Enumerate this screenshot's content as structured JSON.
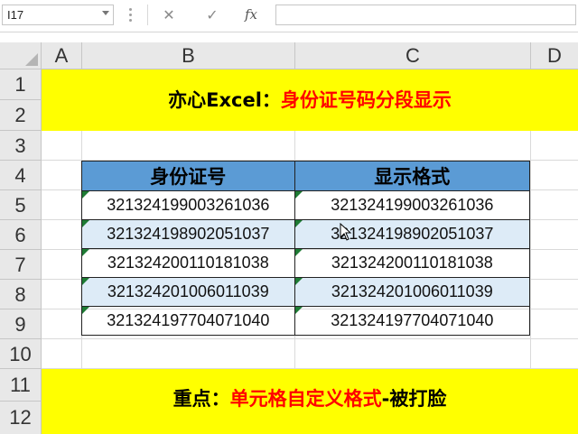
{
  "formula_bar": {
    "name_box": "I17",
    "cancel_icon": "✕",
    "confirm_icon": "✓",
    "fx_label": "fx",
    "formula_value": ""
  },
  "columns": [
    "A",
    "B",
    "C",
    "D"
  ],
  "rows": [
    "1",
    "2",
    "3",
    "4",
    "5",
    "6",
    "7",
    "8",
    "9",
    "10",
    "11",
    "12"
  ],
  "title_banner": {
    "prefix": "亦心Excel：",
    "highlight": "身份证号码分段显示"
  },
  "table": {
    "headers": [
      "身份证号",
      "显示格式"
    ],
    "rows": [
      [
        "321324199003261036",
        "321324199003261036"
      ],
      [
        "321324198902051037",
        "321324198902051037"
      ],
      [
        "321324200110181038",
        "321324200110181038"
      ],
      [
        "321324201006011039",
        "321324201006011039"
      ],
      [
        "321324197704071040",
        "321324197704071040"
      ]
    ]
  },
  "footer_banner": {
    "prefix": "重点：",
    "highlight": "单元格自定义格式",
    "suffix": "-被打脸"
  },
  "colors": {
    "banner_bg": "#ffff00",
    "highlight_text": "#ff0000",
    "header_bg": "#5b9bd5",
    "band_bg": "#ddebf7",
    "error_flag": "#1e7b34"
  }
}
